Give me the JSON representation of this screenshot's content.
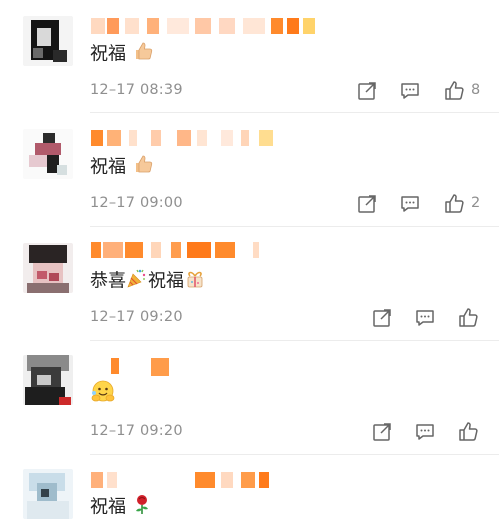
{
  "comments": [
    {
      "text": "祝福",
      "emojis": [
        "thumbs-up-icon"
      ],
      "time": "12–17 08:39",
      "likes": "8"
    },
    {
      "text": "祝福",
      "emojis": [
        "thumbs-up-icon"
      ],
      "time": "12–17 09:00",
      "likes": "2"
    },
    {
      "text_before": "恭喜",
      "text_after": "祝福",
      "emojis": [
        "party-popper-icon",
        "gift-ribbon-icon"
      ],
      "time": "12–17 09:20",
      "likes": ""
    },
    {
      "text": "",
      "emojis": [
        "hugging-face-icon"
      ],
      "time": "12–17 09:20",
      "likes": ""
    },
    {
      "text": "祝福",
      "emojis": [
        "rose-icon"
      ],
      "time": "",
      "likes": ""
    }
  ],
  "actions": {
    "share": "share-icon",
    "comment": "comment-icon",
    "like": "thumbs-up-outline-icon"
  },
  "colors": {
    "accent": "#ff8a2c",
    "text": "#222222",
    "muted": "#8f8f8f"
  }
}
